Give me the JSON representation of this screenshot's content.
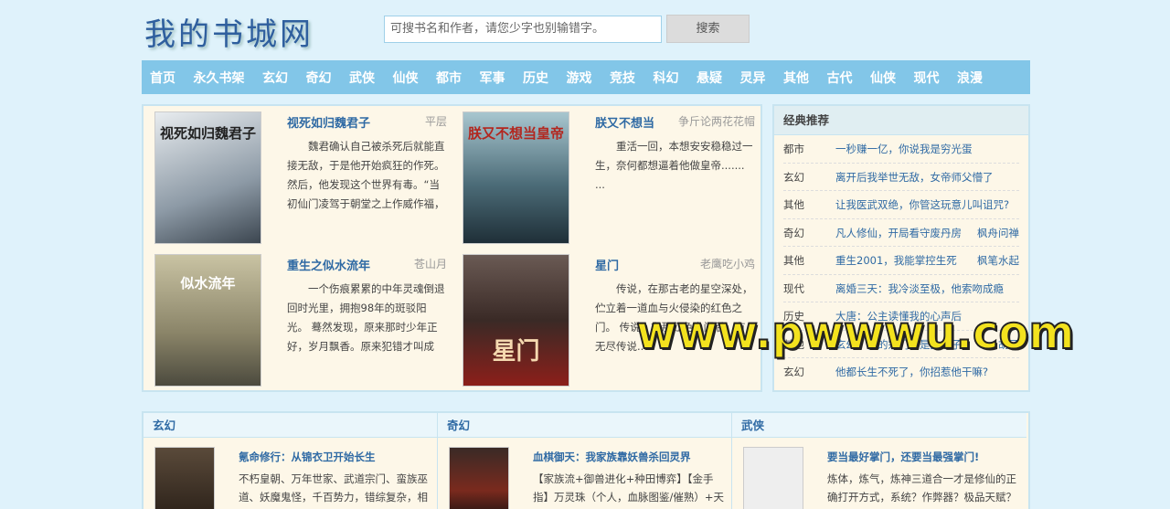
{
  "header": {
    "logo": "我的书城网",
    "search_placeholder": "可搜书名和作者，请您少字也别输错字。",
    "search_button": "搜索"
  },
  "nav": [
    "首页",
    "永久书架",
    "玄幻",
    "奇幻",
    "武侠",
    "仙侠",
    "都市",
    "军事",
    "历史",
    "游戏",
    "竞技",
    "科幻",
    "悬疑",
    "灵异",
    "其他",
    "古代",
    "仙侠",
    "现代",
    "浪漫"
  ],
  "featured": [
    {
      "title": "视死如归魏君子",
      "author": "平层",
      "desc": "魏君确认自己被杀死后就能直接无敌，于是他开始疯狂的作死。然后，他发现这个世界有毒。“当初仙门凌驾于朝堂之上作威作福，",
      "cover_text": "视死如归魏君子",
      "cover_color": "#c9d3dc"
    },
    {
      "title": "朕又不想当",
      "author": "争斤论两花花帽",
      "desc": "重活一回，本想安安稳稳过一生，奈何都想逼着他做皇帝.......  ...",
      "cover_text": "朕又不想当皇帝",
      "cover_color": "#6f8e9b"
    },
    {
      "title": "重生之似水流年",
      "author": "苍山月",
      "desc": "一个伤痕累累的中年灵魂倒退回时光里，拥抱98年的斑驳阳光。 蓦然发现，原来那时少年正好，岁月飘香。原来犯错才叫成",
      "cover_text": "似水流年",
      "cover_color": "#a9a384"
    },
    {
      "title": "星门",
      "author": "老鹰吃小鸡",
      "desc": "传说，在那古老的星空深处，伫立着一道血与火侵染的红色之门。 传说，在那红色之门后，有无尽传说...",
      "cover_text": "星门",
      "cover_color": "#4a3c38"
    }
  ],
  "recommend": {
    "heading": "经典推荐",
    "items": [
      {
        "cat": "都市",
        "title": "一秒赚一亿，你说我是穷光蛋",
        "author": ""
      },
      {
        "cat": "玄幻",
        "title": "离开后我举世无敌，女帝师父懵了",
        "author": ""
      },
      {
        "cat": "其他",
        "title": "让我医武双绝，你管这玩意儿叫诅咒?",
        "author": ""
      },
      {
        "cat": "奇幻",
        "title": "凡人修仙，开局看守废丹房",
        "author": "枫舟问禅"
      },
      {
        "cat": "其他",
        "title": "重生2001，我能掌控生死",
        "author": "枫笔水起"
      },
      {
        "cat": "现代",
        "title": "离婚三天：我冷淡至极，他索吻成瘾",
        "author": ""
      },
      {
        "cat": "历史",
        "title": "大唐：公主读懂我的心声后",
        "author": ""
      },
      {
        "cat": "其他",
        "title": "玄幻：我的宗门全是女弟子",
        "author": "胡子"
      },
      {
        "cat": "玄幻",
        "title": "他都长生不死了，你招惹他干嘛?",
        "author": ""
      }
    ]
  },
  "categories": [
    {
      "name": "玄幻",
      "title": "氪命修行：从锦衣卫开始长生",
      "desc": "不朽皇朝、万年世家、武道宗门、蛮族巫道、妖魔鬼怪，千百势力，错综复杂，相互纠缠！陈凡，学聪之，成为大周皇朝的",
      "cover_color": "#3a3228"
    },
    {
      "name": "奇幻",
      "title": "血棋御天：我家族靠妖兽杀回灵界",
      "desc": "【家族流+御兽进化+种田博弈】【金手指】万灵珠（个人，血脉图鉴/催熟）+天元棋盘（家族，凝聚位/归墟）【简介】天",
      "cover_color": "#2a1e1c"
    },
    {
      "name": "武侠",
      "title": "要当最好掌门，还要当最强掌门!",
      "desc": "炼体，炼气，炼神三道合一才是修仙的正确打开方式，系统？作弊器？极品天赋？我觉话人遍遇不要再，论修仙境发展，我",
      "cover_color": "#efefef"
    }
  ],
  "watermark": "www.pwwwu.com"
}
